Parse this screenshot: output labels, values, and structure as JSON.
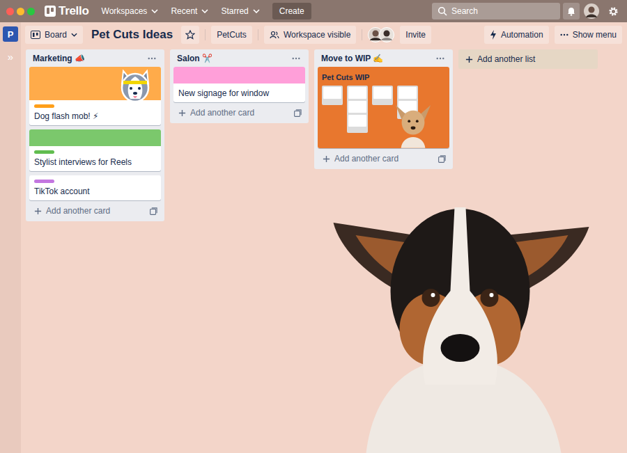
{
  "topbar": {
    "logo": "Trello",
    "nav": [
      {
        "label": "Workspaces"
      },
      {
        "label": "Recent"
      },
      {
        "label": "Starred"
      }
    ],
    "create": "Create",
    "search": {
      "placeholder": "Search"
    }
  },
  "sidebar": {
    "workspace_badge": "P",
    "expand": "»"
  },
  "board_header": {
    "view": "Board",
    "title": "Pet Cuts Ideas",
    "starred": false,
    "workspace": "PetCuts",
    "visibility": "Workspace visible",
    "invite": "Invite",
    "automation": "Automation",
    "menu": "Show menu"
  },
  "lists": [
    {
      "title": "Marketing 📣",
      "add_card": "Add another card",
      "cards": [
        {
          "kind": "cover",
          "title": "Dog flash mob! ⚡",
          "cover": {
            "color": "#ffab4a",
            "sticker": true
          },
          "label": {
            "color": "#ff9f1a"
          }
        },
        {
          "kind": "cover",
          "title": "Stylist interviews for Reels",
          "cover": {
            "color": "#7bc86c",
            "sticker": false
          },
          "label": {
            "color": "#61bd4f"
          }
        },
        {
          "kind": "plain",
          "title": "TikTok account",
          "label": {
            "color": "#c377e0"
          }
        }
      ]
    },
    {
      "title": "Salon ✂️",
      "add_card": "Add another card",
      "cards": [
        {
          "kind": "cover",
          "title": "New signage for window",
          "cover": {
            "color": "#ff9fd9",
            "sticker": false
          },
          "label": null
        }
      ]
    },
    {
      "title": "Move to WIP ✍️",
      "add_card": "Add another card",
      "cards": [
        {
          "kind": "image",
          "cover": {
            "color": "#e8772e",
            "title": "Pet Cuts WIP",
            "columns": [
              1,
              3,
              1,
              2
            ]
          }
        }
      ]
    }
  ],
  "add_list": "Add another list"
}
